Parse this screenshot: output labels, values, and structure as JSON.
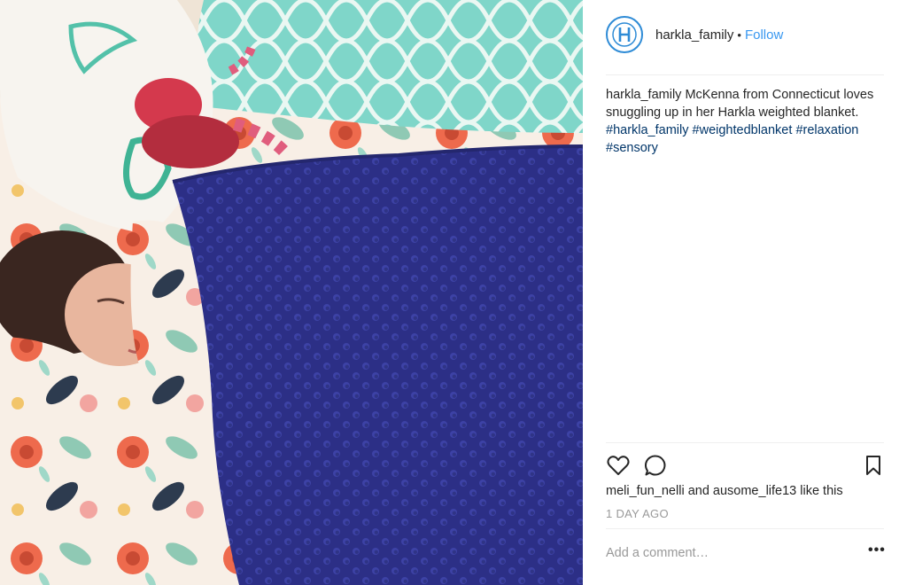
{
  "post": {
    "username": "harkla_family",
    "separator": "•",
    "follow_label": "Follow",
    "caption": {
      "username": "harkla_family",
      "text": " McKenna from Connecticut loves snuggling up in her Harkla weighted blanket. ",
      "hashtags": [
        "#harkla_family",
        "#weightedblanket",
        "#relaxation",
        "#sensory"
      ]
    },
    "likes_text": "meli_fun_nelli and ausome_life13 like this",
    "timestamp": "1 DAY AGO",
    "comment_placeholder": "Add a comment…",
    "more_label": "•••"
  },
  "icons": {
    "like": "heart-icon",
    "comment": "comment-icon",
    "save": "bookmark-icon",
    "avatar": "harkla-logo"
  },
  "colors": {
    "link": "#3897f0",
    "hashtag": "#003569",
    "blanket": "#2c2f86",
    "avatar_ring": "#2e8bd6"
  }
}
